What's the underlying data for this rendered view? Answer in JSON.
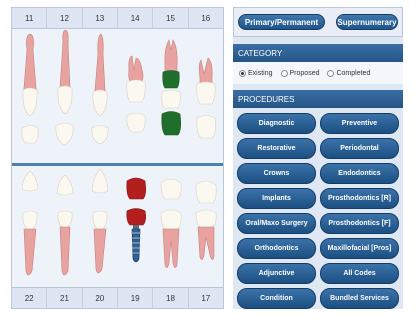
{
  "chart": {
    "upper_numbers": [
      "11",
      "12",
      "13",
      "14",
      "15",
      "16"
    ],
    "lower_numbers": [
      "22",
      "21",
      "20",
      "19",
      "18",
      "17"
    ]
  },
  "tooth_type": {
    "primary_label": "Primary/Permanent",
    "supernumerary_label": "Supernumerary"
  },
  "category": {
    "heading": "CATEGORY",
    "options": [
      "Existing",
      "Proposed",
      "Completed"
    ],
    "selected": "Existing"
  },
  "procedures": {
    "heading": "PROCEDURES",
    "buttons": [
      "Diagnostic",
      "Preventive",
      "Restorative",
      "Periodontal",
      "Crowns",
      "Endodontics",
      "Implants",
      "Prosthodontics [R]",
      "Oral/Maxo Surgery",
      "Prosthodontics [F]",
      "Orthodontics",
      "Maxillofacial [Pros]",
      "Adjunctive",
      "All Codes",
      "Condition",
      "Bundled Services"
    ]
  },
  "colors": {
    "accent_blue": "#245585",
    "treatment_green": "#1f6e2c",
    "treatment_red": "#b31f1f",
    "implant_blue": "#2f5f8f"
  }
}
